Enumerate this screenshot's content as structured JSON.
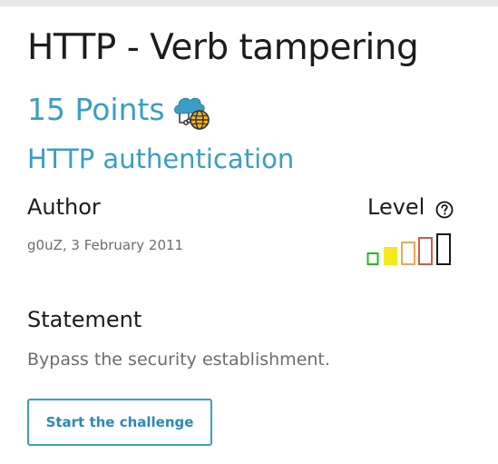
{
  "challenge": {
    "title": "HTTP - Verb tampering",
    "points": "15 Points",
    "category_icon": "cloud-network-globe-icon",
    "category": "HTTP authentication"
  },
  "author": {
    "label": "Author",
    "meta": "g0uZ,  3 February 2011"
  },
  "level": {
    "label": "Level",
    "help_icon": "question-circle-icon",
    "value": 2,
    "max": 5,
    "colors": [
      "#2ab52a",
      "#f4e81a",
      "#e8a85a",
      "#d65a40",
      "#1a1a1a"
    ]
  },
  "statement": {
    "label": "Statement",
    "text": "Bypass the security establishment."
  },
  "actions": {
    "start_label": "Start the challenge"
  },
  "colors": {
    "accent": "#3a9ec4",
    "muted_text": "#6d6d6d"
  }
}
